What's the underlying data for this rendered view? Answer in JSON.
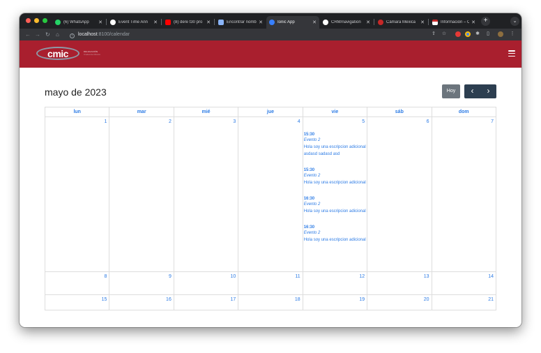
{
  "browser": {
    "tabs": [
      {
        "title": "(6) WhatsApp",
        "icon": "whatsapp-icon",
        "color": "#25d366",
        "active": false
      },
      {
        "title": "Event Time Ann",
        "icon": "event-icon",
        "color": "#ffffff",
        "active": false
      },
      {
        "title": "(8) dere t30 pro",
        "icon": "youtube-icon",
        "color": "#ff0000",
        "active": false
      },
      {
        "title": "Encontrar nomb",
        "icon": "doc-icon",
        "color": "#8ab4f8",
        "active": false
      },
      {
        "title": "Ionic App",
        "icon": "ionic-icon",
        "color": "#3880ff",
        "active": true
      },
      {
        "title": "CRM/navigation",
        "icon": "github-icon",
        "color": "#ffffff",
        "active": false
      },
      {
        "title": "Cámara Mexica",
        "icon": "cmic-icon",
        "color": "#c62828",
        "active": false
      },
      {
        "title": "Información – C",
        "icon": "info-icon",
        "color": "#ffffff",
        "active": false
      }
    ],
    "new_tab": "+",
    "tab_menu": "⌄",
    "url_host": "localhost",
    "url_path": ":8100/calendar"
  },
  "app": {
    "logo_text": "cmic",
    "logo_tag_line1": "DELEGACIÓN",
    "logo_tag_line2": "Ciudad de México"
  },
  "calendar": {
    "title": "mayo de 2023",
    "today_label": "Hoy",
    "prev_label": "‹",
    "next_label": "›",
    "weekdays": [
      "lun",
      "mar",
      "mié",
      "jue",
      "vie",
      "sáb",
      "dom"
    ],
    "weeks": [
      [
        "1",
        "2",
        "3",
        "4",
        "5",
        "6",
        "7"
      ],
      [
        "8",
        "9",
        "10",
        "11",
        "12",
        "13",
        "14"
      ],
      [
        "15",
        "16",
        "17",
        "18",
        "19",
        "20",
        "21"
      ]
    ],
    "events_day_5": [
      {
        "time": "15:30",
        "name": "Evento 2",
        "desc": "Hola soy una escripcion adicional asdasd sadasd asd"
      },
      {
        "time": "15:30",
        "name": "Evento 2",
        "desc": "Hola soy una escripcion adicional"
      },
      {
        "time": "16:30",
        "name": "Evento 2",
        "desc": "Hola soy una escripcion adicional"
      },
      {
        "time": "16:30",
        "name": "Evento 2",
        "desc": "Hola soy una escripcion adicional"
      }
    ]
  },
  "colors": {
    "header_red": "#a91f2e",
    "link_blue": "#2c7be5",
    "today_button": "#6c757d",
    "nav_buttons": "#2c3e50"
  }
}
